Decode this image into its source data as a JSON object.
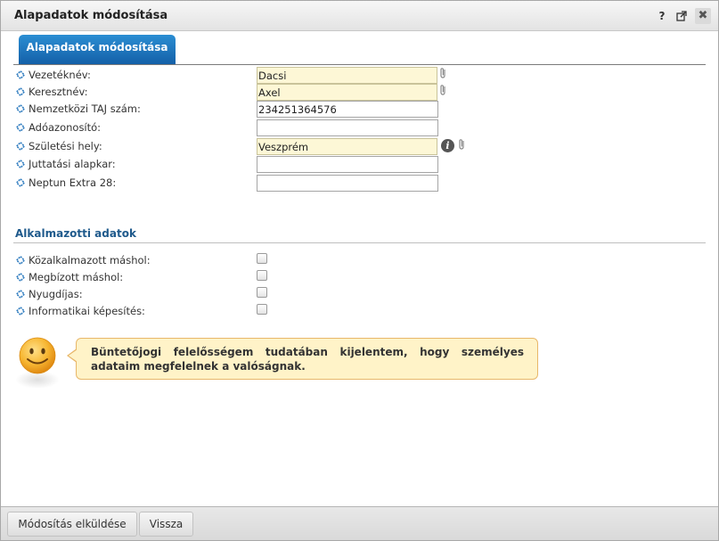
{
  "window": {
    "title": "Alapadatok módosítása",
    "help_label": "?"
  },
  "tabs": [
    {
      "label": "Alapadatok módosítása",
      "active": true
    }
  ],
  "fields": [
    {
      "label": "Vezetéknév:",
      "value": "Dacsi",
      "readonly": true,
      "attachment_icon": true
    },
    {
      "label": "Keresztnév:",
      "value": "Axel",
      "readonly": true,
      "attachment_icon": true
    },
    {
      "label": "Nemzetközi TAJ szám:",
      "value": "234251364576",
      "readonly": false
    },
    {
      "label": "Adóazonosító:",
      "value": "",
      "readonly": false
    },
    {
      "label": "Születési hely:",
      "value": "Veszprém",
      "readonly": true,
      "info_icon": true,
      "attachment_icon": true
    },
    {
      "label": "Juttatási alapkar:",
      "value": "",
      "readonly": false
    },
    {
      "label": "Neptun Extra 28:",
      "value": "",
      "readonly": false
    }
  ],
  "employee_section": {
    "title": "Alkalmazotti adatok",
    "checkboxes": [
      {
        "label": "Közalkalmazott máshol:",
        "checked": false
      },
      {
        "label": "Megbízott máshol:",
        "checked": false
      },
      {
        "label": "Nyugdíjas:",
        "checked": false
      },
      {
        "label": "Informatikai képesítés:",
        "checked": false
      }
    ]
  },
  "notice": {
    "text": "Büntetőjogi felelősségem tudatában kijelentem, hogy személyes adataim megfelelnek a valóságnak."
  },
  "footer": {
    "submit_label": "Módosítás elküldése",
    "back_label": "Vissza"
  },
  "colors": {
    "tab_active": "#1f74bd",
    "readonly_field_bg": "#fdf7d6",
    "section_title": "#1f5a8c",
    "notice_bg": "#fff3c8",
    "notice_border": "#e8b76a"
  }
}
